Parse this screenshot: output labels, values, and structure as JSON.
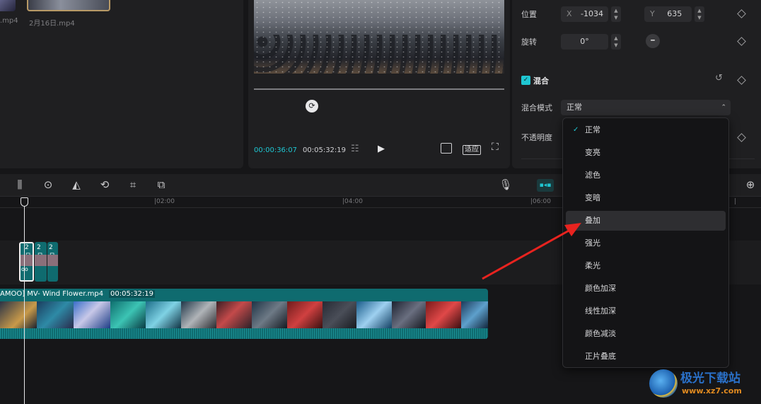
{
  "media": {
    "items": [
      {
        "name": ".mp4"
      },
      {
        "name": "2月16日.mp4"
      }
    ]
  },
  "player": {
    "current_time": "00:00:36:07",
    "total_time": "00:05:32:19",
    "fit_label": "适应"
  },
  "properties": {
    "position_label": "位置",
    "x_axis": "X",
    "x_value": "-1034",
    "y_axis": "Y",
    "y_value": "635",
    "rotation_label": "旋转",
    "rotation_value": "0°",
    "blend_title": "混合",
    "blend_mode_label": "混合模式",
    "blend_mode_value": "正常",
    "opacity_label": "不透明度"
  },
  "blend_menu": {
    "selected": "正常",
    "hovered": "叠加",
    "options": [
      "正常",
      "变亮",
      "滤色",
      "变暗",
      "叠加",
      "强光",
      "柔光",
      "颜色加深",
      "线性加深",
      "颜色减淡",
      "正片叠底"
    ]
  },
  "timeline": {
    "ticks": [
      "|02:00",
      "|04:00",
      "|06:00",
      "|"
    ],
    "small_clip_labels": [
      "2月",
      "2月",
      "2月"
    ],
    "main_clip_name": "AMOO] MV- Wind Flower.mp4",
    "main_clip_duration": "00:05:32:19"
  },
  "watermark": {
    "text": "极光下载站",
    "url": "www.xz7.com"
  },
  "colors": {
    "accent": "#1fc6d2",
    "clip": "#0f6b6f",
    "background": "#161618",
    "panel": "#1f1f21",
    "annotation_arrow": "#e8231f"
  }
}
